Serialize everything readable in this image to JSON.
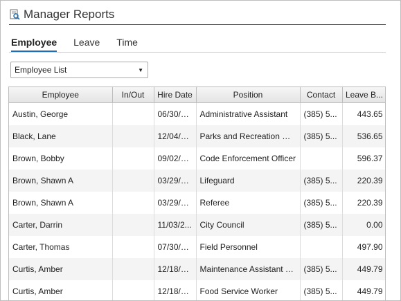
{
  "header": {
    "title": "Manager Reports",
    "icon": "report-icon"
  },
  "tabs": [
    {
      "label": "Employee",
      "active": true
    },
    {
      "label": "Leave",
      "active": false
    },
    {
      "label": "Time",
      "active": false
    }
  ],
  "report_select": {
    "value": "Employee List"
  },
  "table": {
    "columns": [
      "Employee",
      "In/Out",
      "Hire Date",
      "Position",
      "Contact",
      "Leave B..."
    ],
    "rows": [
      [
        "Austin, George",
        "",
        "06/30/2...",
        "Administrative Assistant",
        "(385) 5...",
        "443.65"
      ],
      [
        "Black, Lane",
        "",
        "12/04/2...",
        "Parks and Recreation Dire...",
        "(385) 5...",
        "536.65"
      ],
      [
        "Brown, Bobby",
        "",
        "09/02/2...",
        "Code Enforcement Officer",
        "",
        "596.37"
      ],
      [
        "Brown, Shawn A",
        "",
        "03/29/2...",
        "Lifeguard",
        "(385) 5...",
        "220.39"
      ],
      [
        "Brown, Shawn A",
        "",
        "03/29/2...",
        "Referee",
        "(385) 5...",
        "220.39"
      ],
      [
        "Carter, Darrin",
        "",
        "11/03/2...",
        "City Council",
        "(385) 5...",
        "0.00"
      ],
      [
        "Carter, Thomas",
        "",
        "07/30/2...",
        "Field Personnel",
        "",
        "497.90"
      ],
      [
        "Curtis, Amber",
        "",
        "12/18/2...",
        "Maintenance Assistant - S...",
        "(385) 5...",
        "449.79"
      ],
      [
        "Curtis, Amber",
        "",
        "12/18/2...",
        "Food Service Worker",
        "(385) 5...",
        "449.79"
      ]
    ]
  }
}
